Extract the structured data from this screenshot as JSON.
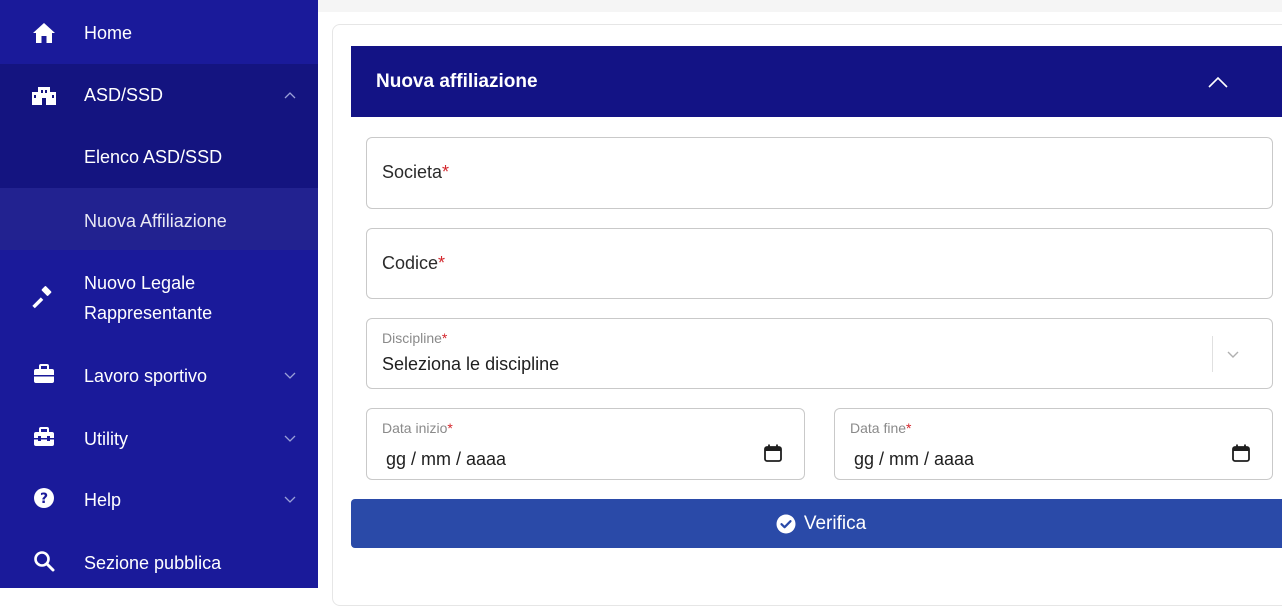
{
  "sidebar": {
    "items": [
      {
        "label": "Home",
        "icon": "home-icon"
      },
      {
        "label": "ASD/SSD",
        "icon": "building-icon"
      },
      {
        "label": "Elenco ASD/SSD"
      },
      {
        "label": "Nuova Affiliazione"
      },
      {
        "label_line1": "Nuovo Legale",
        "label_line2": "Rappresentante",
        "icon": "gavel-icon"
      },
      {
        "label": "Lavoro sportivo",
        "icon": "briefcase-icon"
      },
      {
        "label": "Utility",
        "icon": "toolbox-icon"
      },
      {
        "label": "Help",
        "icon": "help-circle-icon"
      },
      {
        "label": "Sezione pubblica",
        "icon": "search-icon"
      }
    ]
  },
  "panel": {
    "title": "Nuova affiliazione"
  },
  "form": {
    "societa_label": "Societa",
    "codice_label": "Codice",
    "discipline_label": "Discipline",
    "discipline_value": "Seleziona le discipline",
    "data_inizio_label": "Data inizio",
    "data_inizio_value": "gg / mm / aaaa",
    "data_fine_label": "Data fine",
    "data_fine_value": "gg / mm / aaaa",
    "required_mark": "*"
  },
  "actions": {
    "verifica_label": "Verifica"
  },
  "colors": {
    "sidebar_bg": "#1a1a9a",
    "sidebar_sub_bg": "#141480",
    "header_bg": "#131385",
    "button_bg": "#2a4aa8",
    "required": "#d4262c"
  }
}
